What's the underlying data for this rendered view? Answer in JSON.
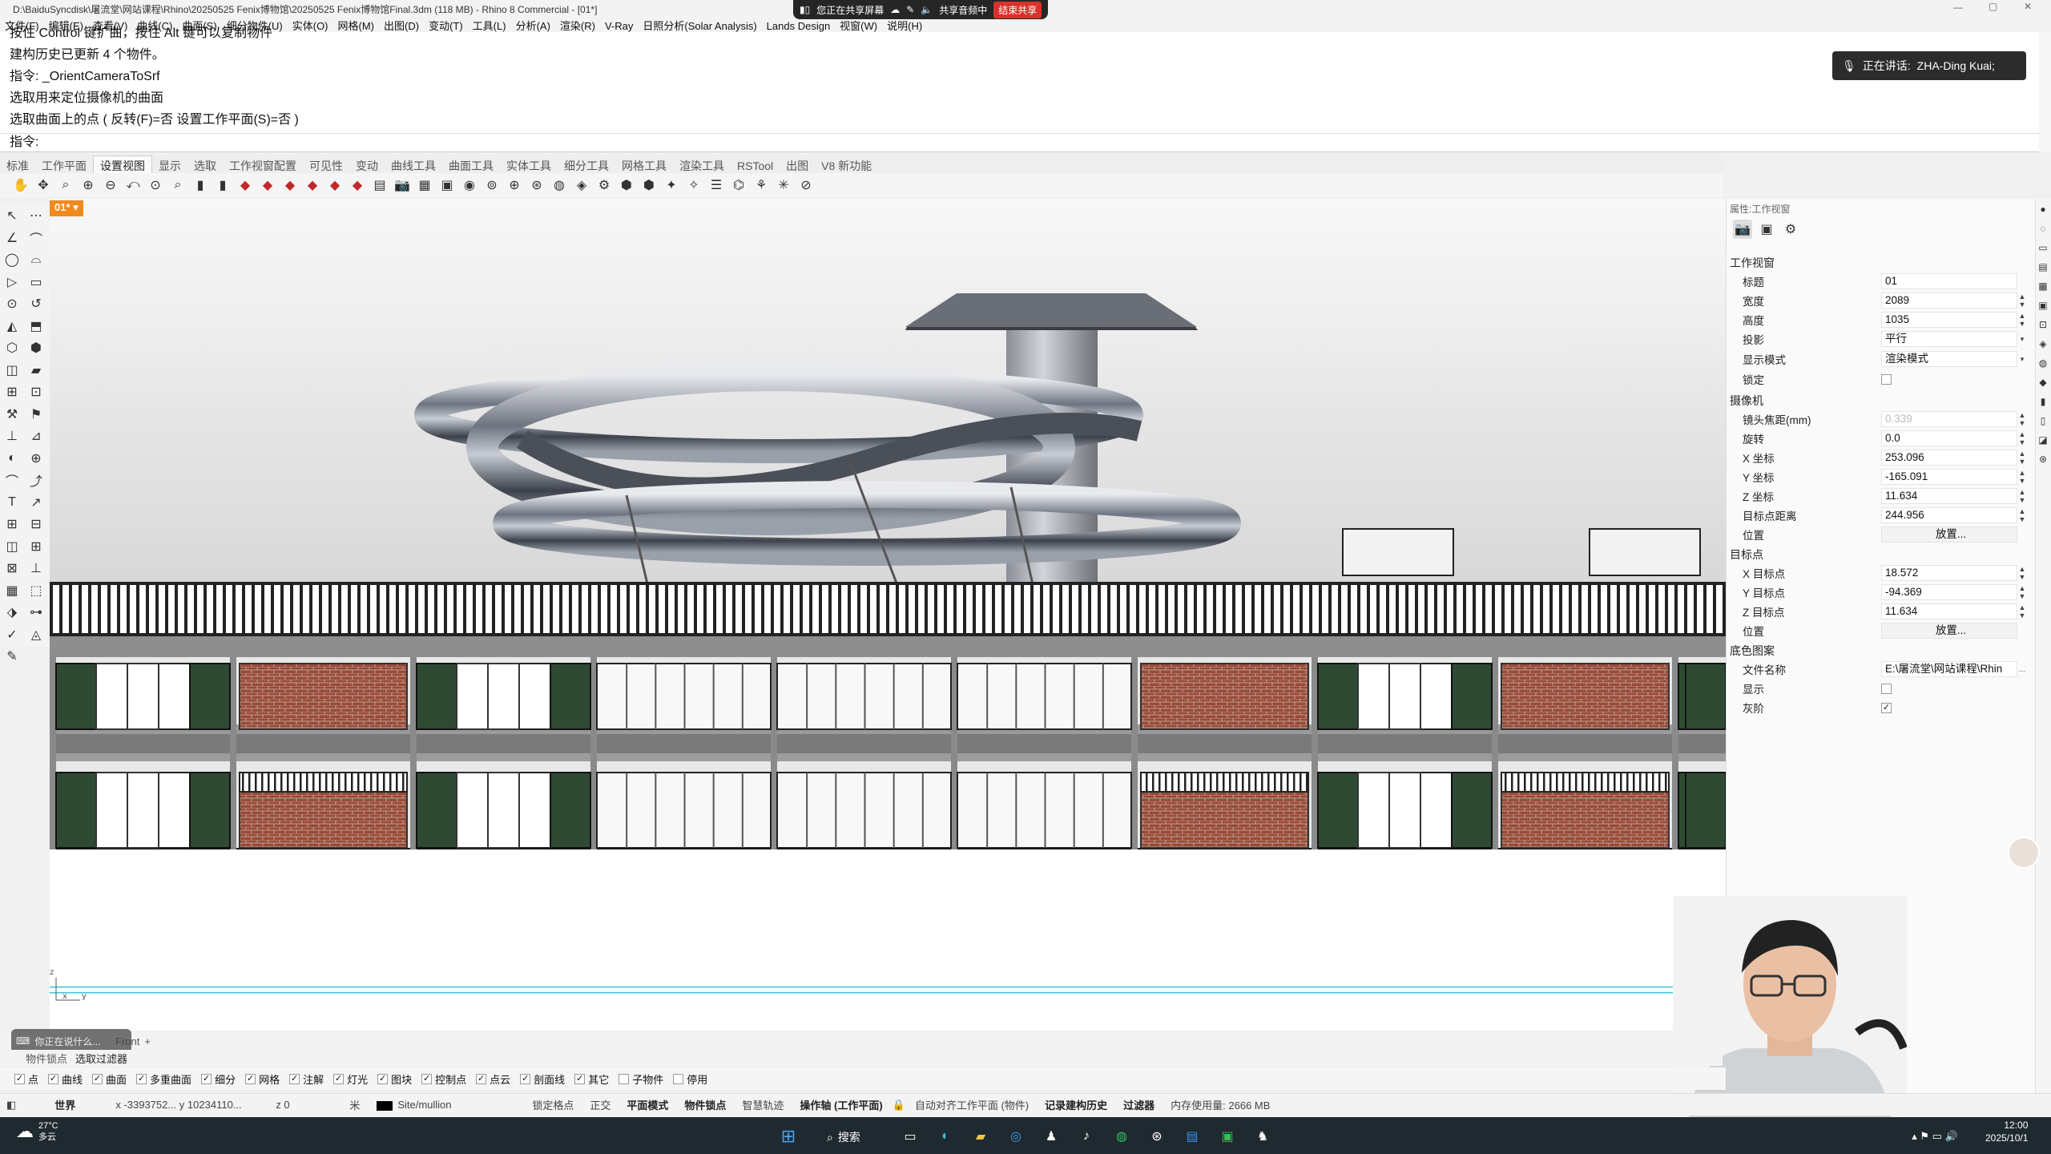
{
  "titlebar": {
    "text": "D:\\BaiduSyncdisk\\屠流堂\\网站课程\\Rhino\\20250525 Fenix博物馆\\20250525 Fenix博物馆Final.3dm (118 MB) - Rhino 8 Commercial - [01*]"
  },
  "menu": [
    "文件(F)",
    "编辑(E)",
    "查看(V)",
    "曲线(C)",
    "曲面(S)",
    "细分物件(U)",
    "实体(O)",
    "网格(M)",
    "出图(D)",
    "变动(T)",
    "工具(L)",
    "分析(A)",
    "渲染(R)",
    "V-Ray",
    "日照分析(Solar Analysis)",
    "Lands Design",
    "视窗(W)",
    "说明(H)"
  ],
  "share": {
    "sharing": "您正在共享屏幕",
    "audio": "共享音频中",
    "end": "结束共享"
  },
  "command_history": [
    "按住 Control 键扩曲，按住 Alt 键可以复制物件",
    "建构历史已更新 4 个物件。",
    "指令: _OrientCameraToSrf",
    "选取用来定位摄像机的曲面",
    "选取曲面上的点 ( 反转(F)=否  设置工作平面(S)=否 )"
  ],
  "command_prompt": "指令:",
  "speaking": {
    "label": "正在讲话:",
    "name": "ZHA-Ding Kuai;"
  },
  "tabs": [
    "标准",
    "工作平面",
    "设置视图",
    "显示",
    "选取",
    "工作视窗配置",
    "可见性",
    "变动",
    "曲线工具",
    "曲面工具",
    "实体工具",
    "细分工具",
    "网格工具",
    "渲染工具",
    "RSTool",
    "出图",
    "V8 新功能"
  ],
  "active_tab": "设置视图",
  "viewport": {
    "label": "01*"
  },
  "properties": {
    "panel_title": "属性:工作视窗",
    "section_viewport": "工作视窗",
    "title_label": "标题",
    "title_value": "01",
    "width_label": "宽度",
    "width_value": "2089",
    "height_label": "高度",
    "height_value": "1035",
    "projection_label": "投影",
    "projection_value": "平行",
    "display_label": "显示模式",
    "display_value": "渲染模式",
    "locked_label": "锁定",
    "section_camera": "摄像机",
    "focal_label": "镜头焦距(mm)",
    "focal_value": "0.339",
    "rotation_label": "旋转",
    "rotation_value": "0.0",
    "camx_label": "X 坐标",
    "camx_value": "253.096",
    "camy_label": "Y 坐标",
    "camy_value": "-165.091",
    "camz_label": "Z 坐标",
    "camz_value": "11.634",
    "targetdist_label": "目标点距离",
    "targetdist_value": "244.956",
    "position_label": "位置",
    "place_button": "放置...",
    "section_target": "目标点",
    "tx_label": "X 目标点",
    "tx_value": "18.572",
    "ty_label": "Y 目标点",
    "ty_value": "-94.369",
    "tz_label": "Z 目标点",
    "tz_value": "11.634",
    "tposition_label": "位置",
    "tplace_button": "放置...",
    "section_bg": "底色图案",
    "file_label": "文件名称",
    "file_value": "E:\\屠流堂\\网站课程\\Rhin",
    "show_label": "显示",
    "gray_label": "灰阶"
  },
  "viewport_tabs": {
    "chat_hint": "你正在说什么...",
    "front": "Front",
    "add": "+"
  },
  "snap_tabs": [
    "物件锁点",
    "选取过滤器"
  ],
  "filters": [
    {
      "label": "点",
      "checked": true
    },
    {
      "label": "曲线",
      "checked": true
    },
    {
      "label": "曲面",
      "checked": true
    },
    {
      "label": "多重曲面",
      "checked": true
    },
    {
      "label": "细分",
      "checked": true
    },
    {
      "label": "网格",
      "checked": true
    },
    {
      "label": "注解",
      "checked": true
    },
    {
      "label": "灯光",
      "checked": true
    },
    {
      "label": "图块",
      "checked": true
    },
    {
      "label": "控制点",
      "checked": true
    },
    {
      "label": "点云",
      "checked": true
    },
    {
      "label": "剖面线",
      "checked": true
    },
    {
      "label": "其它",
      "checked": true
    },
    {
      "label": "子物件",
      "checked": false
    },
    {
      "label": "停用",
      "checked": false
    }
  ],
  "status": {
    "cplane": "世界",
    "coords": "x -3393752...  y 10234110...",
    "z": "z 0",
    "unit": "米",
    "layer": "Site/mullion",
    "grid_snap": "锁定格点",
    "ortho": "正交",
    "planar": "平面模式",
    "osnap": "物件锁点",
    "smarttrack": "智慧轨迹",
    "gumball": "操作轴 (工作平面)",
    "autoalign": "自动对齐工作平面 (物件)",
    "history": "记录建构历史",
    "filter": "过滤器",
    "memory": "内存使用量: 2666 MB"
  },
  "taskbar": {
    "weather_temp": "27°C",
    "weather_desc": "多云",
    "search": "搜索",
    "time": "12:00",
    "date": "2025/10/1"
  },
  "colors": {
    "viewport_accent": "#f08a1d",
    "share_end": "#d9322b",
    "taskbar": "#1f2a30"
  }
}
